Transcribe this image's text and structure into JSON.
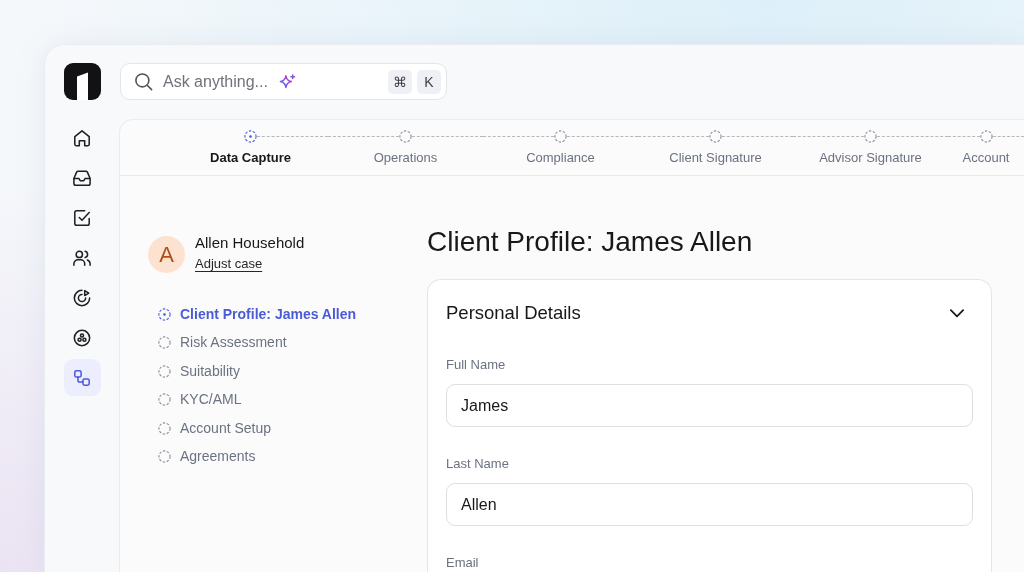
{
  "rail": {
    "items": [
      {
        "selected": false
      },
      {
        "selected": false
      },
      {
        "selected": false
      },
      {
        "selected": false
      },
      {
        "selected": false
      },
      {
        "selected": false
      },
      {
        "selected": true
      }
    ]
  },
  "search": {
    "placeholder": "Ask anything...",
    "shortcut_keys": [
      "⌘",
      "K"
    ]
  },
  "stepper": {
    "steps": [
      {
        "label": "Data Capture",
        "selected": true
      },
      {
        "label": "Operations",
        "selected": false
      },
      {
        "label": "Compliance",
        "selected": false
      },
      {
        "label": "Client Signature",
        "selected": false
      },
      {
        "label": "Advisor Signature",
        "selected": false
      },
      {
        "label": "Account",
        "selected": false
      }
    ]
  },
  "case": {
    "initial": "A",
    "name": "Allen Household",
    "link": "Adjust case"
  },
  "section_nav": {
    "items": [
      {
        "label": "Client Profile: James Allen",
        "selected": true
      },
      {
        "label": "Risk Assessment",
        "selected": false
      },
      {
        "label": "Suitability",
        "selected": false
      },
      {
        "label": "KYC/AML",
        "selected": false
      },
      {
        "label": "Account Setup",
        "selected": false
      },
      {
        "label": "Agreements",
        "selected": false
      }
    ]
  },
  "page_title": "Client Profile: James Allen",
  "card": {
    "title": "Personal Details",
    "expanded": true,
    "fields": [
      {
        "label": "Full Name",
        "value": "James"
      },
      {
        "label": "Last Name",
        "value": "Allen"
      },
      {
        "label": "Email"
      }
    ]
  }
}
